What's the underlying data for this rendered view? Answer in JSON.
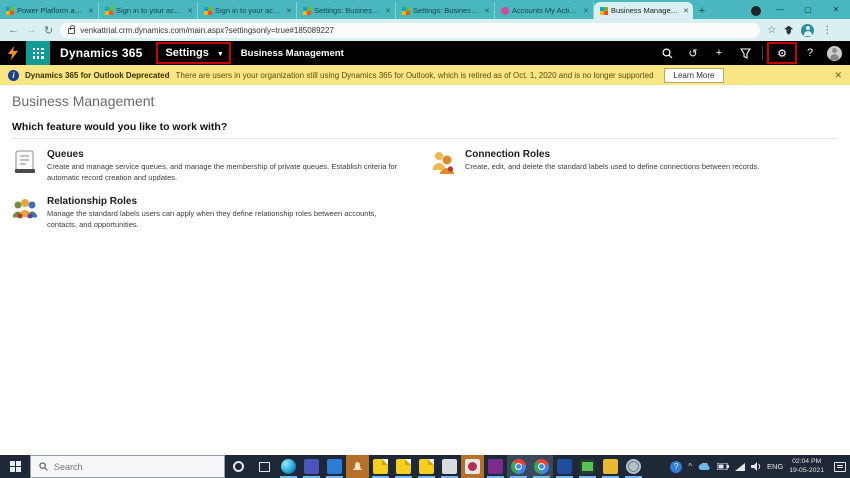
{
  "colors": {
    "accent_teal": "#49b8be",
    "toolbar_teal": "#d9eff1",
    "nav_black": "#000000",
    "waffle_teal": "#129a94",
    "banner_yellow": "#f7e683",
    "highlight_red": "#c90000",
    "taskbar_dark": "#1e2836"
  },
  "browser": {
    "tabs": [
      {
        "title": "Power Platform admi",
        "close": "✕"
      },
      {
        "title": "Sign in to your accou",
        "close": "✕"
      },
      {
        "title": "Sign in to your accou",
        "close": "✕"
      },
      {
        "title": "Settings: Business Ma",
        "close": "✕"
      },
      {
        "title": "Settings: Business Ma",
        "close": "✕"
      },
      {
        "title": "Accounts My Active A",
        "close": "✕"
      },
      {
        "title": "Business Managemen",
        "close": "✕"
      }
    ],
    "new_tab": "+",
    "window_controls": {
      "minimize": "—",
      "maximize": "▢",
      "close": "✕"
    },
    "back": "←",
    "forward": "→",
    "refresh": "↻",
    "address": {
      "url": "venkattrial.crm.dynamics.com/main.aspx?settingsonly=true#185089227"
    },
    "bookmark_star": "☆",
    "menu": "⋮"
  },
  "navbar": {
    "app_title": "Dynamics 365",
    "area_label": "Settings",
    "area_chevron": "▼",
    "page_label": "Business Management",
    "plus": "+",
    "history": "↺",
    "gear": "⚙",
    "help": "?"
  },
  "banner": {
    "info": "i",
    "title": "Dynamics 365 for Outlook Deprecated",
    "message": "There are users in your organization still using Dynamics 365 for Outlook, which is retired as of Oct. 1, 2020 and is no longer supported",
    "action": "Learn More",
    "close": "✕"
  },
  "content": {
    "page_title": "Business Management",
    "question": "Which feature would you like to work with?",
    "features": [
      {
        "title": "Queues",
        "description": "Create and manage service queues, and manage the membership of private queues. Establish criteria for automatic record creation and updates."
      },
      {
        "title": "Connection Roles",
        "description": "Create, edit, and delete the standard labels used to define connections between records."
      },
      {
        "title": "Relationship Roles",
        "description": "Manage the standard labels users can apply when they define relationship roles between accounts, contacts, and opportunities."
      }
    ]
  },
  "taskbar": {
    "search_placeholder": "Search",
    "tray_expand": "^",
    "language": "ENG",
    "time": "02:04 PM",
    "date": "19-05-2021"
  }
}
